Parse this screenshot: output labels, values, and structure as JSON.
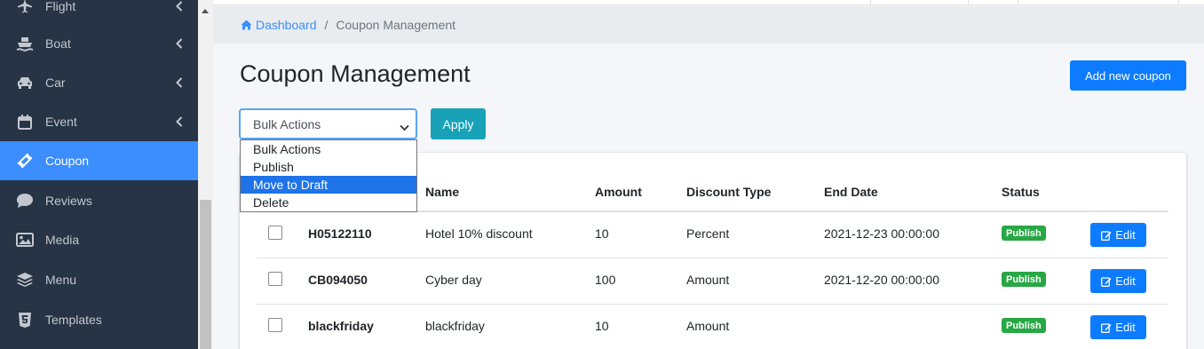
{
  "sidebar": {
    "items": [
      {
        "label": "Flight",
        "icon": "plane-icon"
      },
      {
        "label": "Boat",
        "icon": "ship-icon"
      },
      {
        "label": "Car",
        "icon": "car-icon"
      },
      {
        "label": "Event",
        "icon": "calendar-icon"
      },
      {
        "label": "Coupon",
        "icon": "ticket-icon",
        "active": true
      },
      {
        "label": "Reviews",
        "icon": "comment-icon"
      },
      {
        "label": "Media",
        "icon": "image-icon"
      },
      {
        "label": "Menu",
        "icon": "layers-icon"
      },
      {
        "label": "Templates",
        "icon": "html5-icon"
      }
    ]
  },
  "breadcrumb": {
    "home": "Dashboard",
    "separator": "/",
    "current": "Coupon Management"
  },
  "page": {
    "title": "Coupon Management",
    "add_button": "Add new coupon"
  },
  "bulk": {
    "selected": "Bulk Actions",
    "apply": "Apply",
    "options": [
      "Bulk Actions",
      "Publish",
      "Move to Draft",
      "Delete"
    ],
    "highlighted": "Move to Draft"
  },
  "table": {
    "headers": [
      "Name",
      "Amount",
      "Discount Type",
      "End Date",
      "Status"
    ],
    "rows": [
      {
        "code": "H05122110",
        "name": "Hotel 10% discount",
        "amount": "10",
        "type": "Percent",
        "end_date": "2021-12-23 00:00:00",
        "status": "Publish",
        "action": "Edit"
      },
      {
        "code": "CB094050",
        "name": "Cyber day",
        "amount": "100",
        "type": "Amount",
        "end_date": "2021-12-20 00:00:00",
        "status": "Publish",
        "action": "Edit"
      },
      {
        "code": "blackfriday",
        "name": "blackfriday",
        "amount": "10",
        "type": "Amount",
        "end_date": "",
        "status": "Publish",
        "action": "Edit"
      }
    ]
  },
  "colors": {
    "sidebar_bg": "#263445",
    "active": "#3c8dfd",
    "primary": "#0d7bff",
    "info": "#17a2b8",
    "success": "#28a745"
  }
}
